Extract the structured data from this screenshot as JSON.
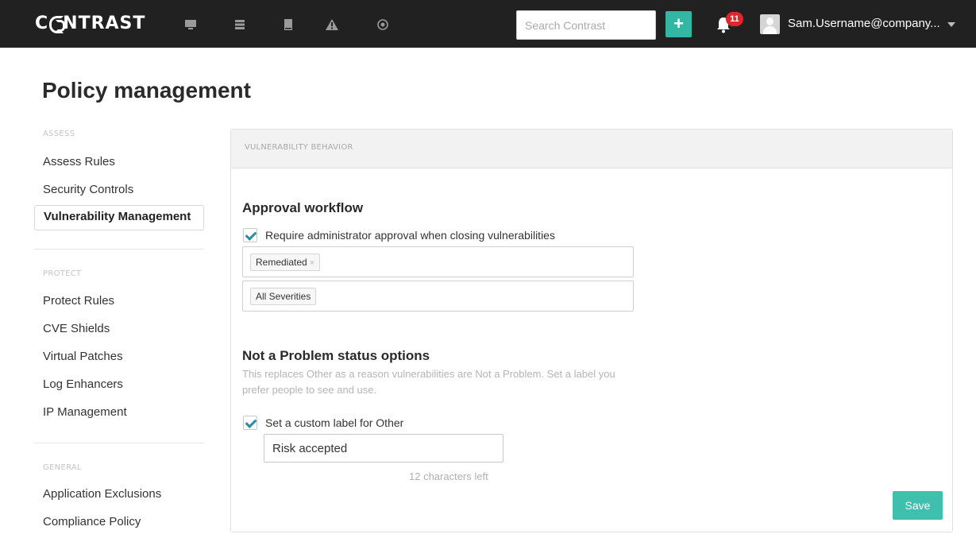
{
  "brand": {
    "logo_text": "NTRAST",
    "logo_full": "CONTRAST",
    "accent": "#34b6a5",
    "badge_color": "#e0252c"
  },
  "header": {
    "nav_icons": [
      "monitor-icon",
      "server-icon",
      "book-icon",
      "warning-icon",
      "target-icon"
    ],
    "search_placeholder": "Search Contrast",
    "add_label": "+",
    "notification_count": "11",
    "username": "Sam.Username@company..."
  },
  "page": {
    "title": "Policy management"
  },
  "sidebar": {
    "assess": {
      "heading": "ASSESS",
      "items": [
        "Assess Rules",
        "Security Controls",
        "Vulnerability Management"
      ]
    },
    "protect": {
      "heading": "PROTECT",
      "items": [
        "Protect Rules",
        "CVE Shields",
        "Virtual Patches",
        "Log Enhancers",
        "IP Management"
      ]
    },
    "general": {
      "heading": "GENERAL",
      "items": [
        "Application Exclusions",
        "Compliance Policy"
      ]
    },
    "active": "Vulnerability Management"
  },
  "panel": {
    "header": "VULNERABILITY BEHAVIOR",
    "approval": {
      "title": "Approval workflow",
      "checkbox_label": "Require administrator approval when closing vulnerabilities",
      "checked": true,
      "status_tag": "Remediated",
      "tag_remove": "×",
      "severity_tag": "All Severities"
    },
    "not_a_problem": {
      "title": "Not a Problem status options",
      "description": "This replaces Other as a reason vulnerabilities are Not a Problem. Set a label you prefer people to see and use.",
      "checkbox_label": "Set a custom label for Other",
      "checked": true,
      "label_value": "Risk accepted",
      "chars_left": "12 characters left"
    },
    "save_label": "Save"
  }
}
